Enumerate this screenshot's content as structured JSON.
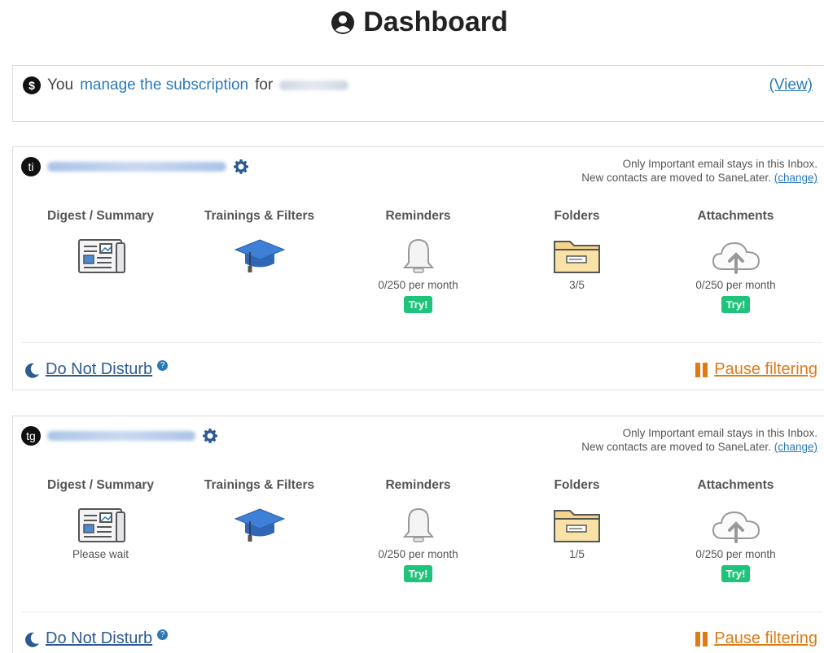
{
  "page": {
    "title": "Dashboard"
  },
  "subscription": {
    "prefix": "You",
    "link_text": "manage the subscription",
    "suffix": "for",
    "view_label": "(View)"
  },
  "accounts": [
    {
      "avatar": "ti",
      "note_line1": "Only Important email stays in this Inbox.",
      "note_line2": "New contacts are moved to SaneLater.",
      "change_label": "(change)",
      "features": [
        {
          "label": "Digest / Summary",
          "icon": "newspaper-icon",
          "sub": ""
        },
        {
          "label": "Trainings & Filters",
          "icon": "graduation-cap-icon",
          "sub": ""
        },
        {
          "label": "Reminders",
          "icon": "bell-icon",
          "sub": "0/250 per month",
          "try": "Try!"
        },
        {
          "label": "Folders",
          "icon": "folder-icon",
          "sub": "3/5"
        },
        {
          "label": "Attachments",
          "icon": "cloud-upload-icon",
          "sub": "0/250 per month",
          "try": "Try!"
        }
      ],
      "dnd_label": "Do Not Disturb",
      "pause_label": "Pause filtering"
    },
    {
      "avatar": "tg",
      "note_line1": "Only Important email stays in this Inbox.",
      "note_line2": "New contacts are moved to SaneLater.",
      "change_label": "(change)",
      "features": [
        {
          "label": "Digest / Summary",
          "icon": "newspaper-icon",
          "sub": "Please wait"
        },
        {
          "label": "Trainings & Filters",
          "icon": "graduation-cap-icon",
          "sub": ""
        },
        {
          "label": "Reminders",
          "icon": "bell-icon",
          "sub": "0/250 per month",
          "try": "Try!"
        },
        {
          "label": "Folders",
          "icon": "folder-icon",
          "sub": "1/5"
        },
        {
          "label": "Attachments",
          "icon": "cloud-upload-icon",
          "sub": "0/250 per month",
          "try": "Try!"
        }
      ],
      "dnd_label": "Do Not Disturb",
      "pause_label": "Pause filtering"
    }
  ],
  "colors": {
    "link": "#2a7ab8",
    "try": "#1ec47a",
    "pause": "#e07a14",
    "dnd": "#2c5b93"
  }
}
